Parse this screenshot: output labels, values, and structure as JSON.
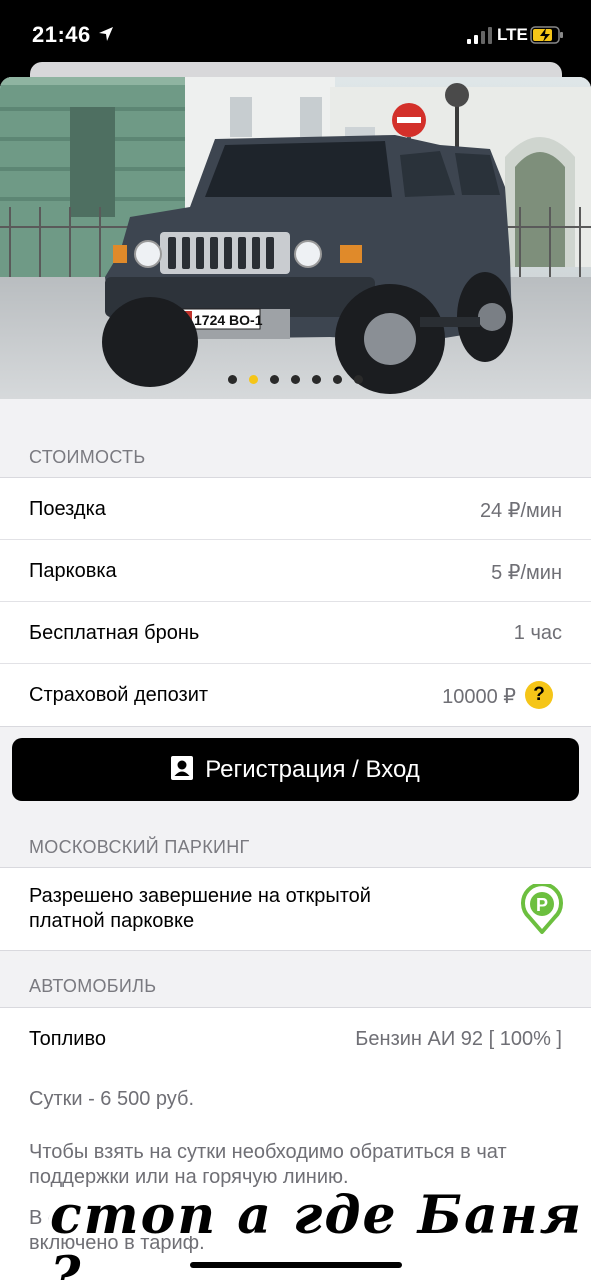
{
  "status_bar": {
    "time": "21:46",
    "network": "LTE"
  },
  "photo": {
    "plate": "1724 BO-1",
    "slides_total": 7,
    "active_slide": 2
  },
  "cost": {
    "header": "СТОИМОСТЬ",
    "rows": [
      {
        "label": "Поездка",
        "value": "24 ₽/мин"
      },
      {
        "label": "Парковка",
        "value": "5 ₽/мин"
      },
      {
        "label": "Бесплатная бронь",
        "value": "1 час"
      },
      {
        "label": "Страховой депозит",
        "value": "10000 ₽"
      }
    ],
    "help_icon": "?"
  },
  "cta": {
    "label": "Регистрация / Вход",
    "icon": "contact-book-icon"
  },
  "moscow_parking": {
    "header": "МОСКОВСКИЙ ПАРКИНГ",
    "line1": "Разрешено завершение на открытой",
    "line2": "платной парковке",
    "icon": "parking-pin-icon"
  },
  "car": {
    "header": "АВТОМОБИЛЬ",
    "fuel_label": "Топливо",
    "fuel_value": "Бензин АИ 92 [ 100% ]",
    "daily": "Сутки - 6 500 руб.",
    "note_line1": "Чтобы взять на сутки необходимо обратиться в чат",
    "note_line2": "поддержки или на горячую линию.",
    "partial_line1": "В с",
    "partial_line2": "включено в тариф."
  },
  "overlay": {
    "text": "стоп а где Баня ?"
  },
  "colors": {
    "accent": "#f5c518",
    "parking_green": "#6cbf3f"
  }
}
